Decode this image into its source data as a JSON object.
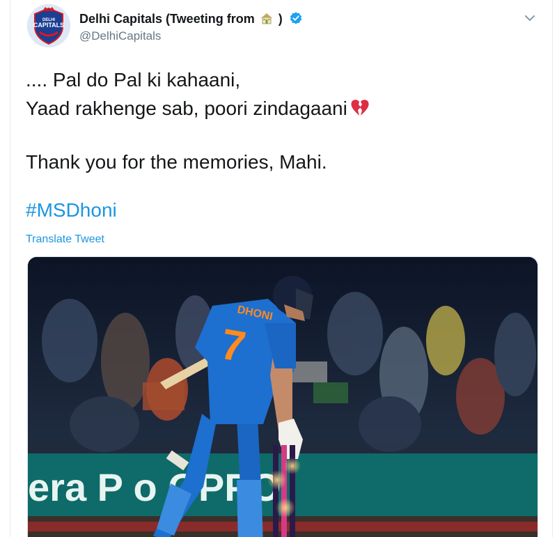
{
  "account": {
    "display_name_pre": "Delhi Capitals (Tweeting from",
    "display_name_post": ")",
    "name_emoji_icon": "house-icon",
    "verified_icon": "verified-badge-icon",
    "handle": "@DelhiCapitals",
    "avatar_text_top": "DELHI",
    "avatar_text_main": "CAPITALS",
    "colors": {
      "brand_blue": "#1b3f93",
      "brand_red": "#d71920"
    }
  },
  "tweet": {
    "lines": [
      ".... Pal do Pal ki kahaani,",
      "Yaad rakhenge sab, poori zindagaani",
      "Thank you for the memories, Mahi."
    ],
    "heart_icon": "broken-heart-icon",
    "hashtag": "#MSDhoni",
    "translate_label": "Translate Tweet"
  },
  "media": {
    "jersey_name": "DHONI",
    "jersey_number": "7",
    "banner_text": "era  P  o  OPPO",
    "colors": {
      "jersey": "#1d6fd0",
      "banner": "#0e6b6a",
      "crowd": "#1a2236"
    }
  },
  "colors": {
    "link": "#1b95e0",
    "text": "#14171a",
    "secondary": "#657786",
    "verified": "#1da1f2"
  }
}
